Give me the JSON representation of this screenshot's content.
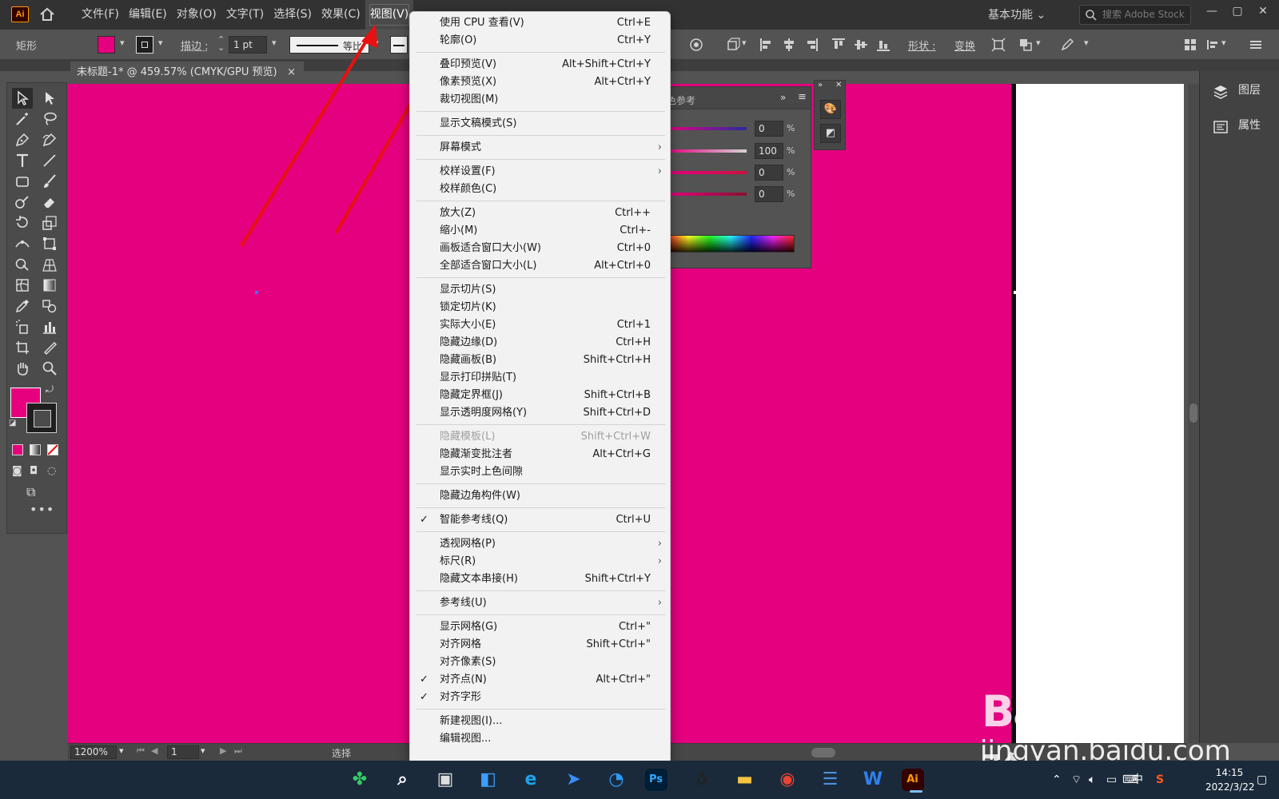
{
  "app": {
    "logo": "Ai"
  },
  "menubar": {
    "items": [
      "文件(F)",
      "编辑(E)",
      "对象(O)",
      "文字(T)",
      "选择(S)",
      "效果(C)",
      "视图(V)"
    ],
    "workspace": "基本功能",
    "search_placeholder": "搜索 Adobe Stock"
  },
  "controlbar": {
    "object_label": "矩形",
    "stroke_label": "描边 :",
    "stroke_weight": "1 pt",
    "line_style": "等比",
    "shape_label": "形状 :",
    "transform_label": "变换",
    "fill_color": "#e6007e"
  },
  "document": {
    "tab_title": "未标题-1* @ 459.57% (CMYK/GPU 预览)",
    "tab_close": "×",
    "artboard_color": "#e4007f"
  },
  "statusbar": {
    "zoom": "1200%",
    "page": "1",
    "status": "选择"
  },
  "color_panel": {
    "tab": "色参考",
    "values": [
      {
        "value": "0",
        "unit": "%",
        "color": "#2a2aa0"
      },
      {
        "value": "100",
        "unit": "%",
        "color": "#d4d4d4"
      },
      {
        "value": "0",
        "unit": "%",
        "color": "#d01040"
      },
      {
        "value": "0",
        "unit": "%",
        "color": "#8a1030"
      }
    ]
  },
  "right_dock": {
    "layers": "图层",
    "properties": "属性"
  },
  "view_menu": {
    "groups": [
      [
        {
          "label": "使用 CPU 查看(V)",
          "shortcut": "Ctrl+E"
        },
        {
          "label": "轮廓(O)",
          "shortcut": "Ctrl+Y"
        }
      ],
      [
        {
          "label": "叠印预览(V)",
          "shortcut": "Alt+Shift+Ctrl+Y"
        },
        {
          "label": "像素预览(X)",
          "shortcut": "Alt+Ctrl+Y"
        },
        {
          "label": "裁切视图(M)",
          "shortcut": ""
        }
      ],
      [
        {
          "label": "显示文稿模式(S)",
          "shortcut": ""
        }
      ],
      [
        {
          "label": "屏幕模式",
          "shortcut": "",
          "submenu": true
        }
      ],
      [
        {
          "label": "校样设置(F)",
          "shortcut": "",
          "submenu": true
        },
        {
          "label": "校样颜色(C)",
          "shortcut": ""
        }
      ],
      [
        {
          "label": "放大(Z)",
          "shortcut": "Ctrl++"
        },
        {
          "label": "缩小(M)",
          "shortcut": "Ctrl+-"
        },
        {
          "label": "画板适合窗口大小(W)",
          "shortcut": "Ctrl+0"
        },
        {
          "label": "全部适合窗口大小(L)",
          "shortcut": "Alt+Ctrl+0"
        }
      ],
      [
        {
          "label": "显示切片(S)",
          "shortcut": ""
        },
        {
          "label": "锁定切片(K)",
          "shortcut": ""
        },
        {
          "label": "实际大小(E)",
          "shortcut": "Ctrl+1"
        },
        {
          "label": "隐藏边缘(D)",
          "shortcut": "Ctrl+H"
        },
        {
          "label": "隐藏画板(B)",
          "shortcut": "Shift+Ctrl+H"
        },
        {
          "label": "显示打印拼贴(T)",
          "shortcut": ""
        },
        {
          "label": "隐藏定界框(J)",
          "shortcut": "Shift+Ctrl+B"
        },
        {
          "label": "显示透明度网格(Y)",
          "shortcut": "Shift+Ctrl+D"
        }
      ],
      [
        {
          "label": "隐藏模板(L)",
          "shortcut": "Shift+Ctrl+W",
          "disabled": true
        },
        {
          "label": "隐藏渐变批注者",
          "shortcut": "Alt+Ctrl+G"
        },
        {
          "label": "显示实时上色间隙",
          "shortcut": ""
        }
      ],
      [
        {
          "label": "隐藏边角构件(W)",
          "shortcut": ""
        }
      ],
      [
        {
          "label": "智能参考线(Q)",
          "shortcut": "Ctrl+U",
          "checked": true
        }
      ],
      [
        {
          "label": "透视网格(P)",
          "shortcut": "",
          "submenu": true
        },
        {
          "label": "标尺(R)",
          "shortcut": "",
          "submenu": true
        },
        {
          "label": "隐藏文本串接(H)",
          "shortcut": "Shift+Ctrl+Y"
        }
      ],
      [
        {
          "label": "参考线(U)",
          "shortcut": "",
          "submenu": true
        }
      ],
      [
        {
          "label": "显示网格(G)",
          "shortcut": "Ctrl+\""
        },
        {
          "label": "对齐网格",
          "shortcut": "Shift+Ctrl+\""
        },
        {
          "label": "对齐像素(S)",
          "shortcut": ""
        },
        {
          "label": "对齐点(N)",
          "shortcut": "Alt+Ctrl+\"",
          "checked": true
        },
        {
          "label": "对齐字形",
          "shortcut": "",
          "checked": true
        }
      ],
      [
        {
          "label": "新建视图(I)...",
          "shortcut": ""
        },
        {
          "label": "编辑视图...",
          "shortcut": ""
        }
      ]
    ]
  },
  "annotations": {
    "arrow_color": "#e81010"
  },
  "taskbar": {
    "apps": [
      "start-icon",
      "search-icon",
      "task-view-icon",
      "widgets-icon",
      "edge-icon",
      "feishu-icon",
      "qq-browser-icon",
      "Ps",
      "qq-icon",
      "file-explorer-icon",
      "chrome-icon",
      "notepad-icon",
      "wps-icon",
      "Ai"
    ],
    "ime": "中",
    "time": "14:15",
    "date": "2022/3/22"
  },
  "watermark": {
    "logo": "Bai du 经验",
    "url": "jingyan.baidu.com"
  }
}
